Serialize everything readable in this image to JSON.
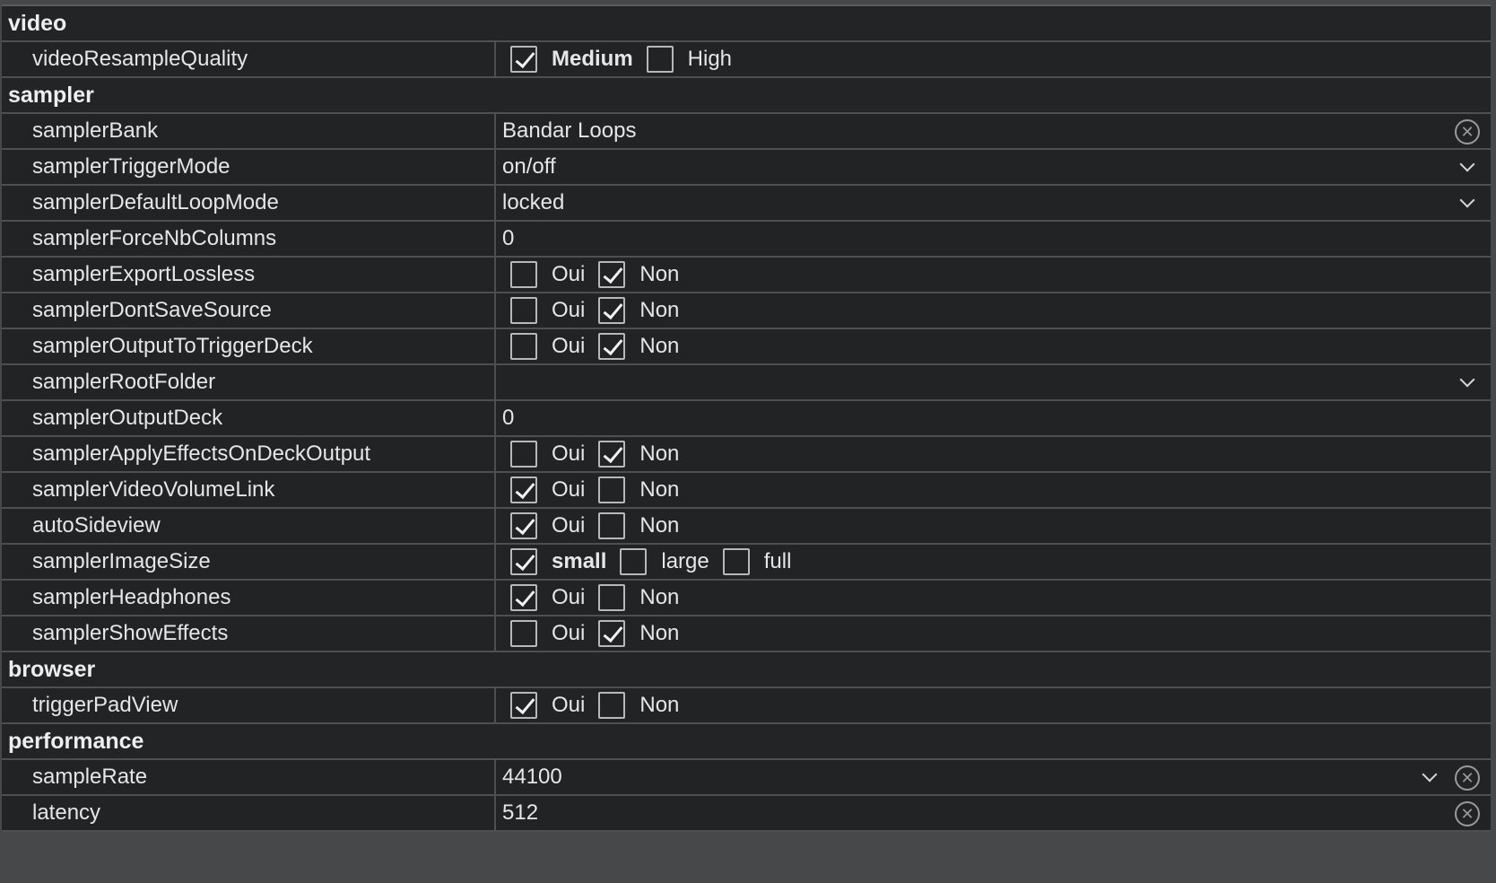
{
  "sections": [
    {
      "title": "video",
      "rows": [
        {
          "label": "videoResampleQuality",
          "type": "checkboxes",
          "options": [
            {
              "label": "Medium",
              "checked": true,
              "bold": true
            },
            {
              "label": "High",
              "checked": false,
              "bold": false
            }
          ]
        }
      ]
    },
    {
      "title": "sampler",
      "rows": [
        {
          "label": "samplerBank",
          "type": "text",
          "value": "Bandar Loops",
          "clear": true,
          "dropdown": false
        },
        {
          "label": "samplerTriggerMode",
          "type": "text",
          "value": "on/off",
          "clear": false,
          "dropdown": true
        },
        {
          "label": "samplerDefaultLoopMode",
          "type": "text",
          "value": "locked",
          "clear": false,
          "dropdown": true
        },
        {
          "label": "samplerForceNbColumns",
          "type": "text",
          "value": "0",
          "clear": false,
          "dropdown": false
        },
        {
          "label": "samplerExportLossless",
          "type": "checkboxes",
          "options": [
            {
              "label": "Oui",
              "checked": false,
              "bold": false
            },
            {
              "label": "Non",
              "checked": true,
              "bold": false
            }
          ]
        },
        {
          "label": "samplerDontSaveSource",
          "type": "checkboxes",
          "options": [
            {
              "label": "Oui",
              "checked": false,
              "bold": false
            },
            {
              "label": "Non",
              "checked": true,
              "bold": false
            }
          ]
        },
        {
          "label": "samplerOutputToTriggerDeck",
          "type": "checkboxes",
          "options": [
            {
              "label": "Oui",
              "checked": false,
              "bold": false
            },
            {
              "label": "Non",
              "checked": true,
              "bold": false
            }
          ]
        },
        {
          "label": "samplerRootFolder",
          "type": "text",
          "value": "",
          "clear": false,
          "dropdown": true
        },
        {
          "label": "samplerOutputDeck",
          "type": "text",
          "value": "0",
          "clear": false,
          "dropdown": false
        },
        {
          "label": "samplerApplyEffectsOnDeckOutput",
          "type": "checkboxes",
          "options": [
            {
              "label": "Oui",
              "checked": false,
              "bold": false
            },
            {
              "label": "Non",
              "checked": true,
              "bold": false
            }
          ]
        },
        {
          "label": "samplerVideoVolumeLink",
          "type": "checkboxes",
          "options": [
            {
              "label": "Oui",
              "checked": true,
              "bold": false
            },
            {
              "label": "Non",
              "checked": false,
              "bold": false
            }
          ]
        },
        {
          "label": "autoSideview",
          "type": "checkboxes",
          "options": [
            {
              "label": "Oui",
              "checked": true,
              "bold": false
            },
            {
              "label": "Non",
              "checked": false,
              "bold": false
            }
          ]
        },
        {
          "label": "samplerImageSize",
          "type": "checkboxes",
          "options": [
            {
              "label": "small",
              "checked": true,
              "bold": true
            },
            {
              "label": "large",
              "checked": false,
              "bold": false
            },
            {
              "label": "full",
              "checked": false,
              "bold": false
            }
          ]
        },
        {
          "label": "samplerHeadphones",
          "type": "checkboxes",
          "options": [
            {
              "label": "Oui",
              "checked": true,
              "bold": false
            },
            {
              "label": "Non",
              "checked": false,
              "bold": false
            }
          ]
        },
        {
          "label": "samplerShowEffects",
          "type": "checkboxes",
          "options": [
            {
              "label": "Oui",
              "checked": false,
              "bold": false
            },
            {
              "label": "Non",
              "checked": true,
              "bold": false
            }
          ]
        }
      ]
    },
    {
      "title": "browser",
      "rows": [
        {
          "label": "triggerPadView",
          "type": "checkboxes",
          "options": [
            {
              "label": "Oui",
              "checked": true,
              "bold": false
            },
            {
              "label": "Non",
              "checked": false,
              "bold": false
            }
          ]
        }
      ]
    },
    {
      "title": "performance",
      "rows": [
        {
          "label": "sampleRate",
          "type": "text",
          "value": "44100",
          "clear": true,
          "dropdown": true
        },
        {
          "label": "latency",
          "type": "text",
          "value": "512",
          "clear": true,
          "dropdown": false
        }
      ]
    }
  ],
  "icons": {
    "check": "checkmark-icon",
    "chevron": "chevron-down-icon",
    "clear": "clear-circle-icon"
  },
  "colors": {
    "background": "#222324",
    "border": "#4e4f51",
    "text": "#e6e6e6"
  }
}
